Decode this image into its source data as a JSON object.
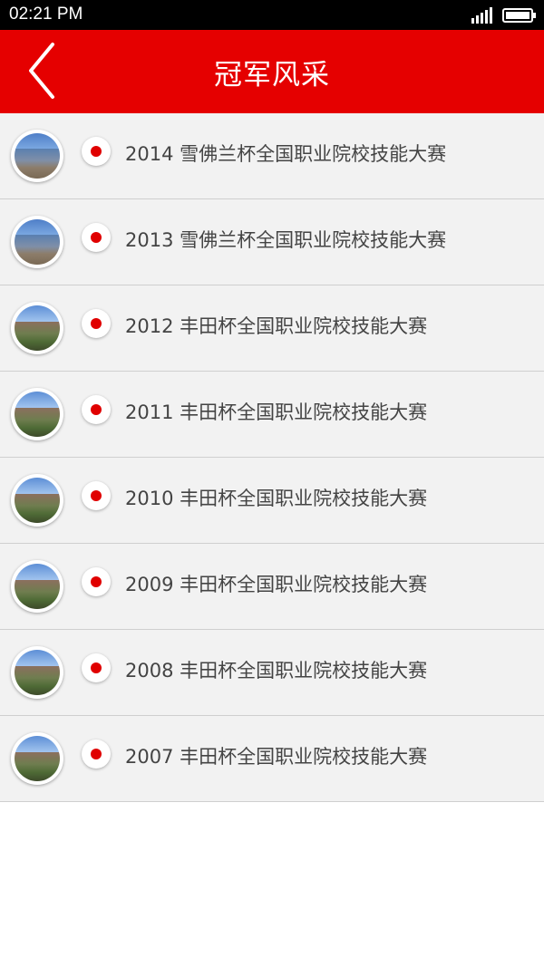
{
  "status_bar": {
    "time": "02:21 PM"
  },
  "app_bar": {
    "title": "冠军风采"
  },
  "list": {
    "items": [
      {
        "label": "2014 雪佛兰杯全国职业院校技能大赛"
      },
      {
        "label": "2013 雪佛兰杯全国职业院校技能大赛"
      },
      {
        "label": "2012 丰田杯全国职业院校技能大赛"
      },
      {
        "label": "2011 丰田杯全国职业院校技能大赛"
      },
      {
        "label": "2010 丰田杯全国职业院校技能大赛"
      },
      {
        "label": "2009 丰田杯全国职业院校技能大赛"
      },
      {
        "label": "2008 丰田杯全国职业院校技能大赛"
      },
      {
        "label": "2007 丰田杯全国职业院校技能大赛"
      }
    ]
  },
  "colors": {
    "accent": "#e50000",
    "marker": "#e00000"
  }
}
